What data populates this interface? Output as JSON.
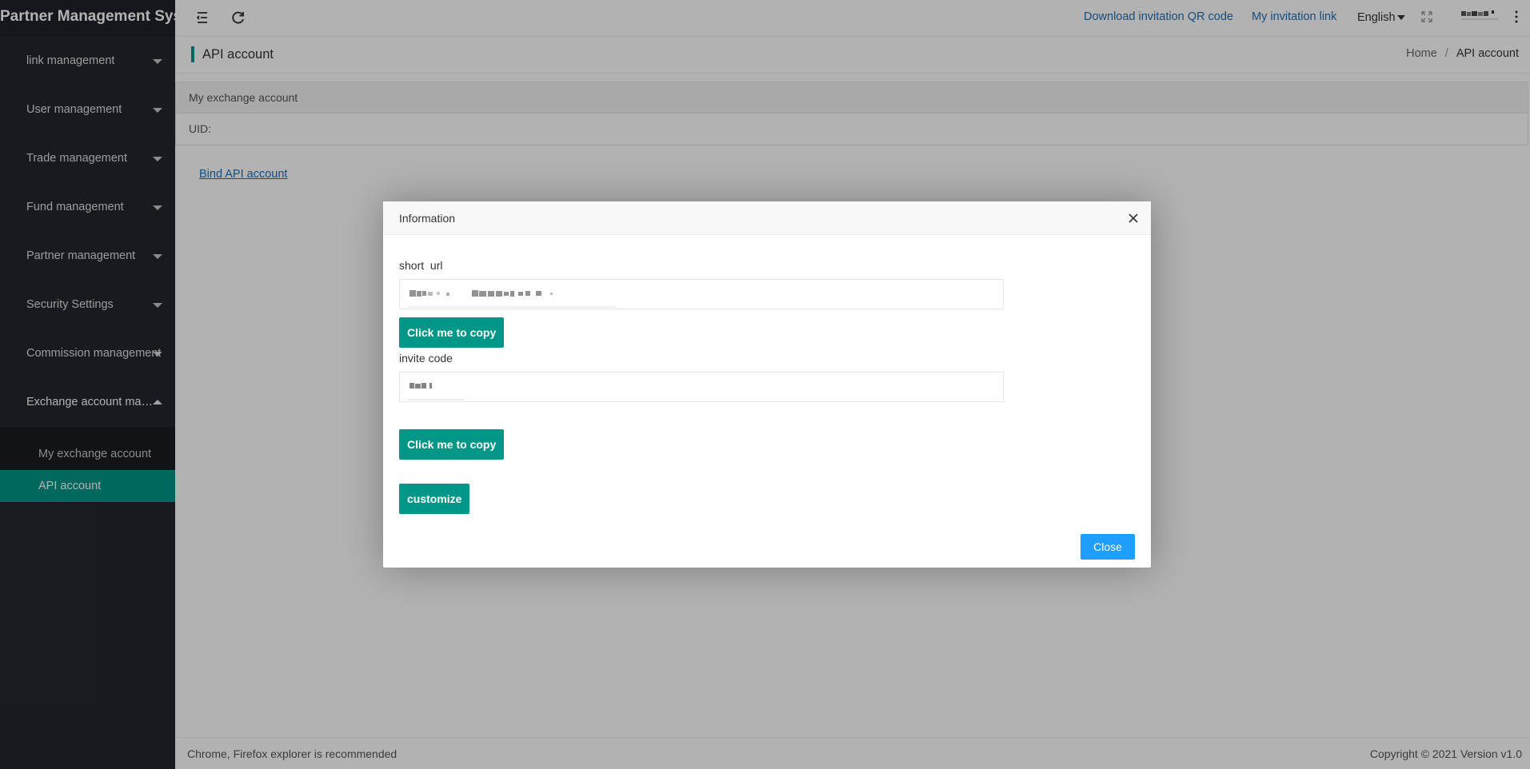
{
  "app": {
    "title": "Partner Management Syst"
  },
  "sidebar": {
    "items": [
      {
        "label": "link management",
        "expanded": false
      },
      {
        "label": "User management",
        "expanded": false
      },
      {
        "label": "Trade management",
        "expanded": false
      },
      {
        "label": "Fund management",
        "expanded": false
      },
      {
        "label": "Partner management",
        "expanded": false
      },
      {
        "label": "Security Settings",
        "expanded": false
      },
      {
        "label": "Commission management",
        "expanded": false
      },
      {
        "label": "Exchange account man...",
        "expanded": true
      }
    ],
    "subitems": [
      {
        "label": "My exchange account",
        "active": false
      },
      {
        "label": "API account",
        "active": true
      }
    ],
    "accent_color": "#009688"
  },
  "topbar": {
    "menu_icon": "menu-fold-icon",
    "refresh_icon": "refresh-icon",
    "download_qr_label": "Download invitation QR code",
    "invitation_link_label": "My invitation link",
    "language_label": "English",
    "fullscreen_icon": "fullscreen-icon",
    "more_icon": "more-vertical-icon"
  },
  "page": {
    "title": "API account",
    "breadcrumb": {
      "home": "Home",
      "separator": "/",
      "current": "API account"
    }
  },
  "content": {
    "table_header": "My exchange account",
    "uid_label": "UID:",
    "bind_link": "Bind API account"
  },
  "footer": {
    "left": "Chrome, Firefox explorer is recommended",
    "right": "Copyright © 2021 Version v1.0"
  },
  "modal": {
    "title": "Information",
    "close_icon": "close-icon",
    "short_url_label": "short  url",
    "copy_button_1": "Click me to copy",
    "invite_code_label": "invite code",
    "copy_button_2": "Click me to copy",
    "customize_button": "customize",
    "close_button": "Close",
    "button_color": "#009688",
    "close_button_color": "#1e9fff"
  }
}
